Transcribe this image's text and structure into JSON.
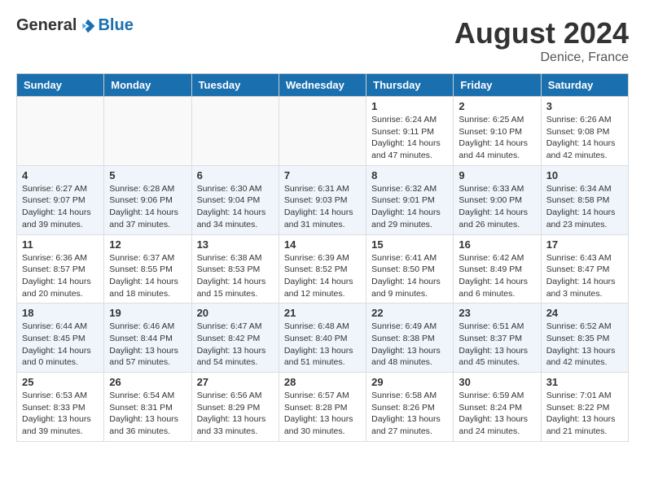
{
  "header": {
    "logo_general": "General",
    "logo_blue": "Blue",
    "month_year": "August 2024",
    "location": "Denice, France"
  },
  "days_of_week": [
    "Sunday",
    "Monday",
    "Tuesday",
    "Wednesday",
    "Thursday",
    "Friday",
    "Saturday"
  ],
  "weeks": [
    [
      {
        "day": "",
        "info": ""
      },
      {
        "day": "",
        "info": ""
      },
      {
        "day": "",
        "info": ""
      },
      {
        "day": "",
        "info": ""
      },
      {
        "day": "1",
        "info": "Sunrise: 6:24 AM\nSunset: 9:11 PM\nDaylight: 14 hours and 47 minutes."
      },
      {
        "day": "2",
        "info": "Sunrise: 6:25 AM\nSunset: 9:10 PM\nDaylight: 14 hours and 44 minutes."
      },
      {
        "day": "3",
        "info": "Sunrise: 6:26 AM\nSunset: 9:08 PM\nDaylight: 14 hours and 42 minutes."
      }
    ],
    [
      {
        "day": "4",
        "info": "Sunrise: 6:27 AM\nSunset: 9:07 PM\nDaylight: 14 hours and 39 minutes."
      },
      {
        "day": "5",
        "info": "Sunrise: 6:28 AM\nSunset: 9:06 PM\nDaylight: 14 hours and 37 minutes."
      },
      {
        "day": "6",
        "info": "Sunrise: 6:30 AM\nSunset: 9:04 PM\nDaylight: 14 hours and 34 minutes."
      },
      {
        "day": "7",
        "info": "Sunrise: 6:31 AM\nSunset: 9:03 PM\nDaylight: 14 hours and 31 minutes."
      },
      {
        "day": "8",
        "info": "Sunrise: 6:32 AM\nSunset: 9:01 PM\nDaylight: 14 hours and 29 minutes."
      },
      {
        "day": "9",
        "info": "Sunrise: 6:33 AM\nSunset: 9:00 PM\nDaylight: 14 hours and 26 minutes."
      },
      {
        "day": "10",
        "info": "Sunrise: 6:34 AM\nSunset: 8:58 PM\nDaylight: 14 hours and 23 minutes."
      }
    ],
    [
      {
        "day": "11",
        "info": "Sunrise: 6:36 AM\nSunset: 8:57 PM\nDaylight: 14 hours and 20 minutes."
      },
      {
        "day": "12",
        "info": "Sunrise: 6:37 AM\nSunset: 8:55 PM\nDaylight: 14 hours and 18 minutes."
      },
      {
        "day": "13",
        "info": "Sunrise: 6:38 AM\nSunset: 8:53 PM\nDaylight: 14 hours and 15 minutes."
      },
      {
        "day": "14",
        "info": "Sunrise: 6:39 AM\nSunset: 8:52 PM\nDaylight: 14 hours and 12 minutes."
      },
      {
        "day": "15",
        "info": "Sunrise: 6:41 AM\nSunset: 8:50 PM\nDaylight: 14 hours and 9 minutes."
      },
      {
        "day": "16",
        "info": "Sunrise: 6:42 AM\nSunset: 8:49 PM\nDaylight: 14 hours and 6 minutes."
      },
      {
        "day": "17",
        "info": "Sunrise: 6:43 AM\nSunset: 8:47 PM\nDaylight: 14 hours and 3 minutes."
      }
    ],
    [
      {
        "day": "18",
        "info": "Sunrise: 6:44 AM\nSunset: 8:45 PM\nDaylight: 14 hours and 0 minutes."
      },
      {
        "day": "19",
        "info": "Sunrise: 6:46 AM\nSunset: 8:44 PM\nDaylight: 13 hours and 57 minutes."
      },
      {
        "day": "20",
        "info": "Sunrise: 6:47 AM\nSunset: 8:42 PM\nDaylight: 13 hours and 54 minutes."
      },
      {
        "day": "21",
        "info": "Sunrise: 6:48 AM\nSunset: 8:40 PM\nDaylight: 13 hours and 51 minutes."
      },
      {
        "day": "22",
        "info": "Sunrise: 6:49 AM\nSunset: 8:38 PM\nDaylight: 13 hours and 48 minutes."
      },
      {
        "day": "23",
        "info": "Sunrise: 6:51 AM\nSunset: 8:37 PM\nDaylight: 13 hours and 45 minutes."
      },
      {
        "day": "24",
        "info": "Sunrise: 6:52 AM\nSunset: 8:35 PM\nDaylight: 13 hours and 42 minutes."
      }
    ],
    [
      {
        "day": "25",
        "info": "Sunrise: 6:53 AM\nSunset: 8:33 PM\nDaylight: 13 hours and 39 minutes."
      },
      {
        "day": "26",
        "info": "Sunrise: 6:54 AM\nSunset: 8:31 PM\nDaylight: 13 hours and 36 minutes."
      },
      {
        "day": "27",
        "info": "Sunrise: 6:56 AM\nSunset: 8:29 PM\nDaylight: 13 hours and 33 minutes."
      },
      {
        "day": "28",
        "info": "Sunrise: 6:57 AM\nSunset: 8:28 PM\nDaylight: 13 hours and 30 minutes."
      },
      {
        "day": "29",
        "info": "Sunrise: 6:58 AM\nSunset: 8:26 PM\nDaylight: 13 hours and 27 minutes."
      },
      {
        "day": "30",
        "info": "Sunrise: 6:59 AM\nSunset: 8:24 PM\nDaylight: 13 hours and 24 minutes."
      },
      {
        "day": "31",
        "info": "Sunrise: 7:01 AM\nSunset: 8:22 PM\nDaylight: 13 hours and 21 minutes."
      }
    ]
  ]
}
